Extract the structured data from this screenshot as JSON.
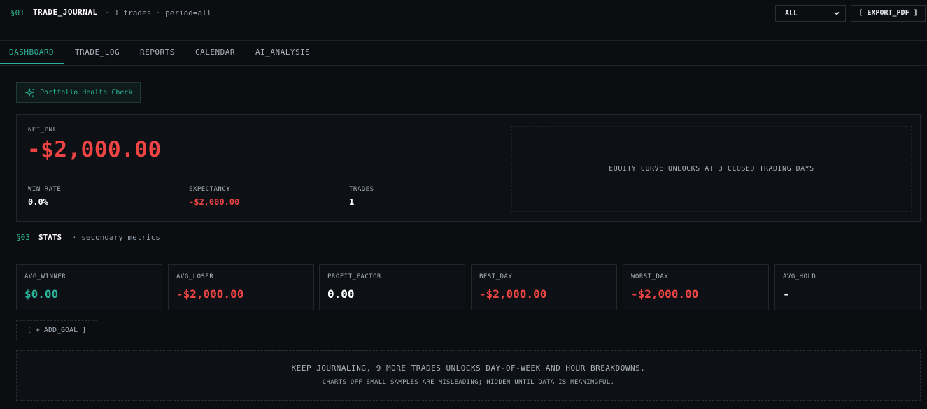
{
  "header": {
    "section": "§01",
    "title": "TRADE_JOURNAL",
    "meta": "· 1 trades · period=all",
    "period_select": "ALL",
    "export_label": "[ EXPORT_PDF ]"
  },
  "tabs": [
    {
      "label": "DASHBOARD",
      "active": true
    },
    {
      "label": "TRADE_LOG"
    },
    {
      "label": "REPORTS"
    },
    {
      "label": "CALENDAR"
    },
    {
      "label": "AI_ANALYSIS"
    }
  ],
  "health_check": {
    "label": "Portfolio Health Check",
    "icon": "sparkle-icon"
  },
  "summary": {
    "net_pnl_label": "NET_PNL",
    "net_pnl": "-$2,000.00",
    "win_rate_label": "WIN_RATE",
    "win_rate": "0.0%",
    "expectancy_label": "EXPECTANCY",
    "expectancy": "-$2,000.00",
    "trades_label": "TRADES",
    "trades": "1",
    "equity_message": "EQUITY CURVE UNLOCKS AT 3 CLOSED TRADING DAYS"
  },
  "stats_header": {
    "section": "§03",
    "title": "STATS",
    "meta": "· secondary metrics"
  },
  "stats": [
    {
      "label": "AVG_WINNER",
      "value": "$0.00",
      "color": "#2bb39a"
    },
    {
      "label": "AVG_LOSER",
      "value": "-$2,000.00",
      "color": "#ef4444"
    },
    {
      "label": "PROFIT_FACTOR",
      "value": "0.00",
      "color": "#ffffff"
    },
    {
      "label": "BEST_DAY",
      "value": "-$2,000.00",
      "color": "#ef4444"
    },
    {
      "label": "WORST_DAY",
      "value": "-$2,000.00",
      "color": "#ef4444"
    },
    {
      "label": "AVG_HOLD",
      "value": "-",
      "color": "#ffffff"
    }
  ],
  "goal_button": "[ + ADD_GOAL ]",
  "note": {
    "line1": "KEEP JOURNALING, 9 MORE TRADES UNLOCKS DAY-OF-WEEK AND HOUR BREAKDOWNS.",
    "line2": "CHARTS OFF SMALL SAMPLES ARE MISLEADING; HIDDEN UNTIL DATA IS MEANINGFUL."
  },
  "colors": {
    "accent": "#2bb39a",
    "negative": "#ef4444",
    "background": "#0b0d10"
  }
}
